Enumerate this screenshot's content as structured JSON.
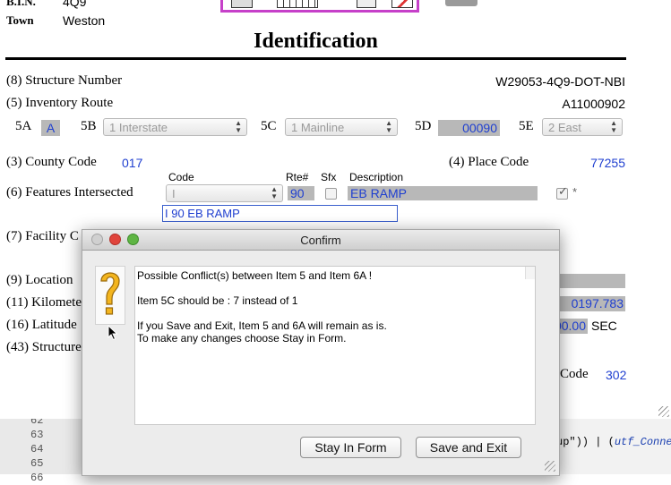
{
  "header": {
    "bin_label": "B.I.N.",
    "bin_value": "4Q9",
    "town_label": "Town",
    "town_value": "Weston",
    "section_title": "Identification"
  },
  "form": {
    "structure_number_label": "(8) Structure Number",
    "structure_number_value": "W29053-4Q9-DOT-NBI",
    "inventory_route_label": "(5) Inventory Route",
    "inventory_route_value": "A11000902",
    "item_5a_label": "5A",
    "item_5a_value": "A",
    "item_5b_label": "5B",
    "item_5b_value": "1 Interstate",
    "item_5c_label": "5C",
    "item_5c_value": "1 Mainline",
    "item_5d_label": "5D",
    "item_5d_value": "00090",
    "item_5e_label": "5E",
    "item_5e_value": "2 East",
    "county_code_label": "(3) County Code",
    "county_code_value": "017",
    "place_code_label": "(4) Place Code",
    "place_code_value": "77255",
    "features_label": "(6) Features Intersected",
    "col_code": "Code",
    "col_rte": "Rte#",
    "col_sfx": "Sfx",
    "col_description": "Description",
    "feature_code_value": "I",
    "feature_rte_value": "90",
    "feature_description_value": "EB  RAMP",
    "feature_star": "*",
    "feature_combined_value": "I  90 EB  RAMP",
    "facility_label": "(7) Facility C",
    "location_label": "(9) Location",
    "kilometer_label": "(11) Kilomete",
    "kilometer_value": "0197.783",
    "latitude_label": "(16) Latitude",
    "latitude_value": "00.00",
    "latitude_unit": "SEC",
    "structure43_label": "(43) Structure",
    "code_label": "Code",
    "code_value": "302"
  },
  "background": {
    "line_numbers": [
      "62",
      "63",
      "64",
      "65",
      "66"
    ],
    "code_fragment_1": "up\")) | (",
    "code_fragment_2": "utf_Connecte"
  },
  "dialog": {
    "title": "Confirm",
    "message_lines": [
      "Possible Conflict(s) between Item 5 and Item 6A !",
      "",
      "Item 5C should be : 7 instead of 1",
      "",
      "If you Save and Exit, Item 5 and 6A will remain as is.",
      "To make any changes choose Stay in Form."
    ],
    "stay_button": "Stay In Form",
    "save_button": "Save and Exit",
    "icon_name": "question-mark-icon",
    "close_color": "#e0443c",
    "minimize_color": "#e8a52c",
    "zoom_color": "#5fb544"
  },
  "colors": {
    "value_blue": "#1f3fd0",
    "field_gray": "#b8b8b8",
    "toolbar_magenta": "#c640c9"
  }
}
